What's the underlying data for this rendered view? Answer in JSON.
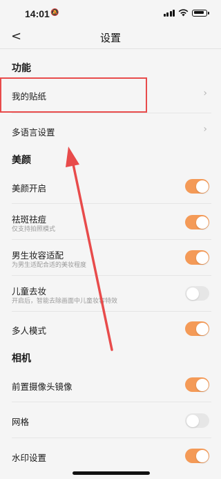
{
  "status": {
    "time": "14:01"
  },
  "nav": {
    "title": "设置"
  },
  "sections": {
    "function": "功能",
    "beauty": "美颜",
    "camera": "相机"
  },
  "rows": {
    "stickers": {
      "label": "我的贴纸"
    },
    "language": {
      "label": "多语言设置"
    },
    "beauty_on": {
      "label": "美颜开启",
      "on": true
    },
    "blemish": {
      "label": "祛斑祛痘",
      "sub": "仅支持拍照模式",
      "on": true
    },
    "male_makeup": {
      "label": "男生妆容适配",
      "sub": "为男生适配合适的美妆程度",
      "on": true
    },
    "child_makeup": {
      "label": "儿童去妆",
      "sub": "开启后，智能去除画面中儿童妆容特效",
      "on": false
    },
    "multi_person": {
      "label": "多人模式",
      "on": true
    },
    "front_mirror": {
      "label": "前置摄像头镜像",
      "on": true
    },
    "grid": {
      "label": "网格",
      "on": false
    },
    "watermark": {
      "label": "水印设置",
      "on": true
    }
  },
  "colors": {
    "accent": "#f49a57",
    "annotation": "#e84b4b",
    "toggle_off": "#e6e6e6"
  },
  "icons": {
    "back": "chevron-left-icon",
    "row_arrow": "chevron-right-icon"
  }
}
